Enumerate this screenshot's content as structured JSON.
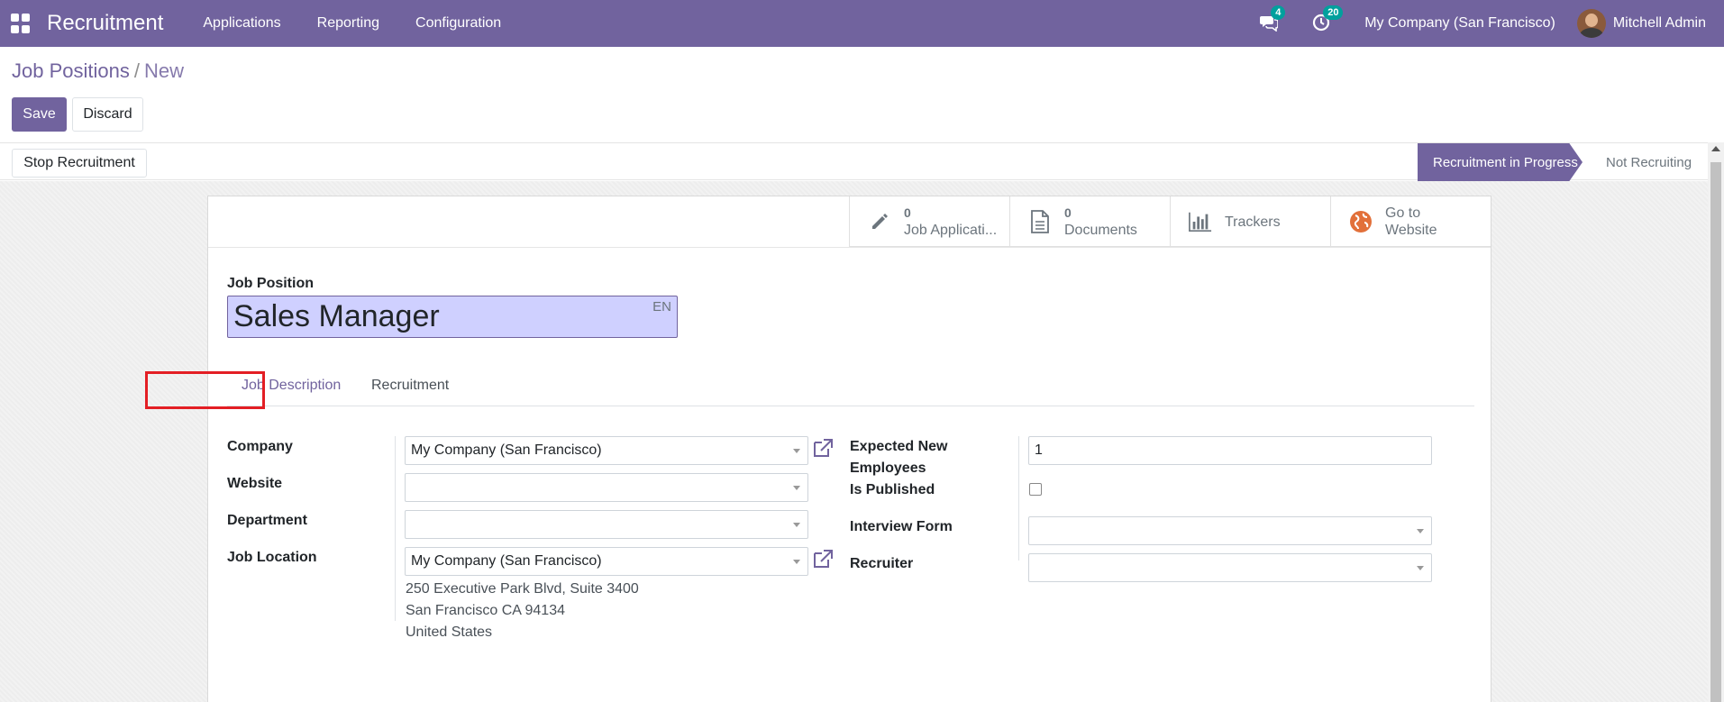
{
  "navbar": {
    "app_title": "Recruitment",
    "menu": [
      "Applications",
      "Reporting",
      "Configuration"
    ],
    "messages_count": "4",
    "activities_count": "20",
    "company": "My Company (San Francisco)",
    "user": "Mitchell Admin"
  },
  "breadcrumb": {
    "parent": "Job Positions",
    "separator": "/",
    "current": "New"
  },
  "toolbar": {
    "save_label": "Save",
    "discard_label": "Discard"
  },
  "statusbar": {
    "stop_label": "Stop Recruitment",
    "stages": [
      {
        "label": "Recruitment in Progress",
        "active": true
      },
      {
        "label": "Not Recruiting",
        "active": false
      }
    ]
  },
  "smart_buttons": [
    {
      "icon": "pencil-icon",
      "count": "0",
      "label": "Job Applicati..."
    },
    {
      "icon": "document-icon",
      "count": "0",
      "label": "Documents"
    },
    {
      "icon": "bar-chart-icon",
      "label": "Trackers"
    },
    {
      "icon": "globe-icon",
      "label_line1": "Go to",
      "label_line2": "Website"
    }
  ],
  "form": {
    "job_position_label": "Job Position",
    "job_position_value": "Sales Manager",
    "lang": "EN",
    "tabs": [
      "Job Description",
      "Recruitment"
    ],
    "left": {
      "company_label": "Company",
      "company_value": "My Company (San Francisco)",
      "website_label": "Website",
      "website_value": "",
      "department_label": "Department",
      "department_value": "",
      "job_location_label": "Job Location",
      "job_location_value": "My Company (San Francisco)",
      "address": [
        "250 Executive Park Blvd, Suite 3400",
        "San Francisco CA 94134",
        "United States"
      ]
    },
    "right": {
      "expected_label_1": "Expected New",
      "expected_label_2": "Employees",
      "expected_value": "1",
      "published_label": "Is Published",
      "published": false,
      "interview_form_label": "Interview Form",
      "interview_form_value": "",
      "recruiter_label": "Recruiter",
      "recruiter_value": ""
    }
  },
  "colors": {
    "brand": "#71639e",
    "highlight": "#e31e24",
    "badge": "#00a09d"
  }
}
